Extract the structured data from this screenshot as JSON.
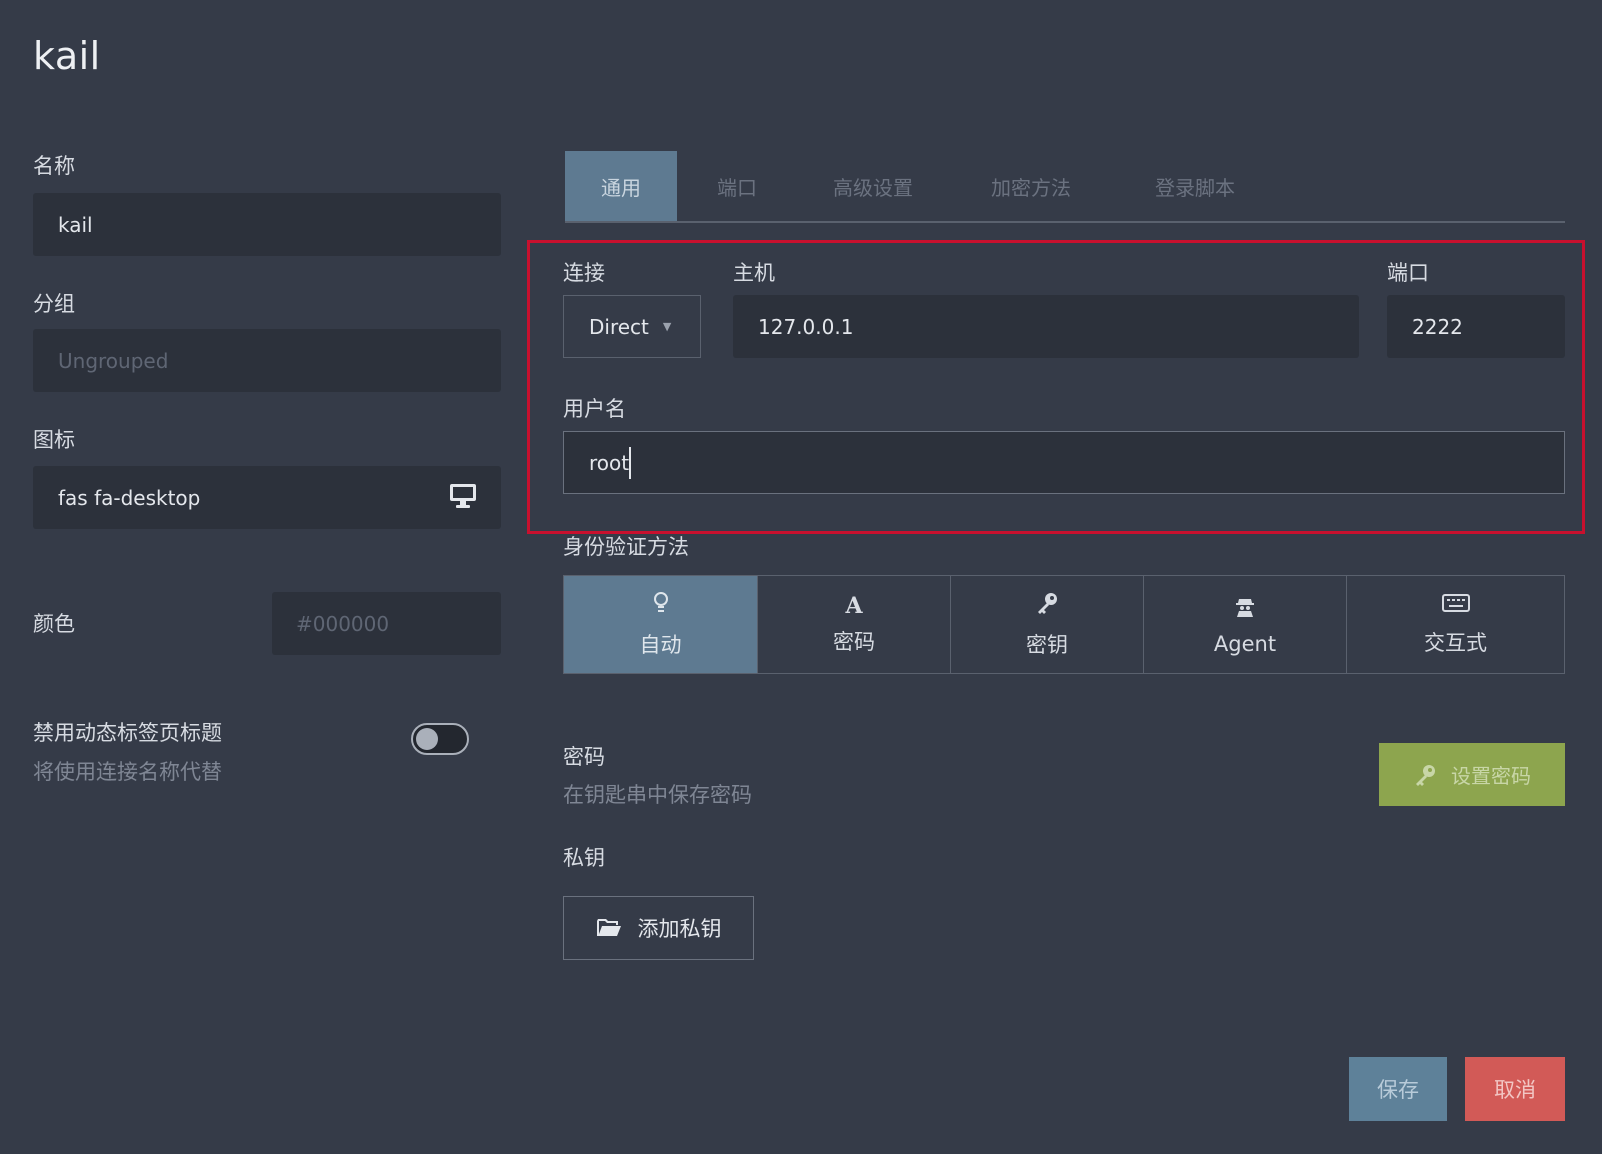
{
  "window": {
    "title": "kail"
  },
  "left": {
    "name_label": "名称",
    "name_value": "kail",
    "group_label": "分组",
    "group_placeholder": "Ungrouped",
    "icon_label": "图标",
    "icon_value": "fas fa-desktop",
    "icon_preview": "desktop-icon",
    "color_label": "颜色",
    "color_placeholder": "#000000",
    "dynamic_title_label": "禁用动态标签页标题",
    "dynamic_title_sub": "将使用连接名称代替",
    "dynamic_title_enabled": false
  },
  "tabs": [
    {
      "label": "通用",
      "active": true
    },
    {
      "label": "端口",
      "active": false
    },
    {
      "label": "高级设置",
      "active": false
    },
    {
      "label": "加密方法",
      "active": false
    },
    {
      "label": "登录脚本",
      "active": false
    }
  ],
  "connection": {
    "type_label": "连接",
    "type_value": "Direct",
    "host_label": "主机",
    "host_value": "127.0.0.1",
    "port_label": "端口",
    "port_value": "2222",
    "username_label": "用户名",
    "username_value": "root"
  },
  "auth": {
    "label": "身份验证方法",
    "options": [
      {
        "icon": "lightbulb-icon",
        "glyph": "💡",
        "label": "自动",
        "active": true
      },
      {
        "icon": "font-icon",
        "glyph": "A",
        "label": "密码",
        "active": false
      },
      {
        "icon": "key-icon",
        "glyph": "🔑",
        "label": "密钥",
        "active": false
      },
      {
        "icon": "user-secret-icon",
        "glyph": "🕵",
        "label": "Agent",
        "active": false
      },
      {
        "icon": "keyboard-icon",
        "glyph": "⌨",
        "label": "交互式",
        "active": false
      }
    ]
  },
  "password": {
    "label": "密码",
    "sub": "在钥匙串中保存密码",
    "set_button": "设置密码"
  },
  "private_key": {
    "label": "私钥",
    "add_button": "添加私钥"
  },
  "footer": {
    "save": "保存",
    "cancel": "取消"
  },
  "colors": {
    "background": "#353b48",
    "field": "#2c313b",
    "tab_active": "#5e7a91",
    "set_password": "#8da54e",
    "save": "#5e8199",
    "cancel": "#d25a57",
    "highlight": "#c8102e"
  }
}
